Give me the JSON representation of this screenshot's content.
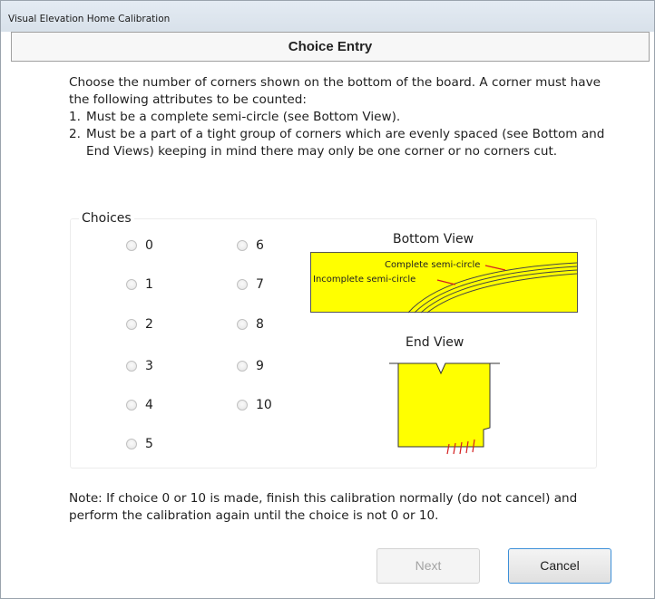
{
  "window": {
    "title": "Visual Elevation Home Calibration"
  },
  "header": {
    "title": "Choice Entry"
  },
  "intro": {
    "paragraph": "Choose the number of corners shown on the bottom of the board.  A corner must have the following attributes to be counted:",
    "items": [
      {
        "num": "1.",
        "text": "Must be a complete semi-circle (see Bottom View)."
      },
      {
        "num": "2.",
        "text": "Must be a part of a tight group of corners which are evenly spaced (see Bottom and End Views) keeping in mind there may only be one corner or no corners cut."
      }
    ]
  },
  "choices": {
    "legend": "Choices",
    "options": [
      "0",
      "1",
      "2",
      "3",
      "4",
      "5",
      "6",
      "7",
      "8",
      "9",
      "10"
    ],
    "selected": null
  },
  "bottom_view": {
    "title": "Bottom View",
    "label_complete": "Complete semi-circle",
    "label_incomplete": "Incomplete semi-circle",
    "fill_color": "#ffff00",
    "arrow_color": "#d42020"
  },
  "end_view": {
    "title": "End View",
    "fill_color": "#ffff00"
  },
  "note": "Note:  If choice 0 or 10 is made, finish this calibration normally (do not cancel) and perform the calibration again until the choice is not 0 or 10.",
  "buttons": {
    "next": "Next",
    "cancel": "Cancel",
    "next_enabled": false
  }
}
